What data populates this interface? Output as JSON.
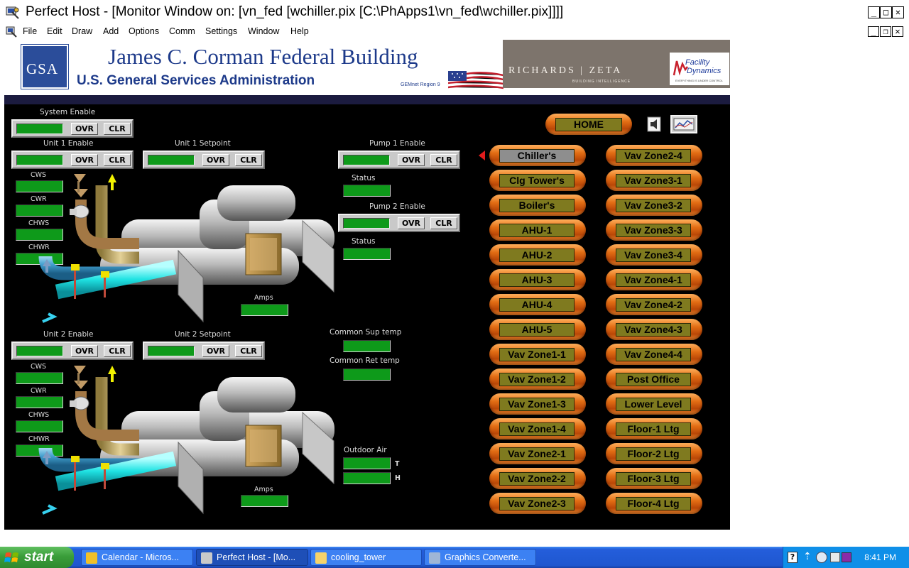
{
  "window": {
    "title": "Perfect Host - [Monitor Window on: [vn_fed [wchiller.pix [C:\\PhApps1\\vn_fed\\wchiller.pix]]]]",
    "menu": [
      "File",
      "Edit",
      "Draw",
      "Add",
      "Options",
      "Comm",
      "Settings",
      "Window",
      "Help"
    ]
  },
  "banner": {
    "logo_text": "GSA",
    "building_name": "James C. Corman Federal Building",
    "agency": "U.S. General Services Administration",
    "region": "GEMnet Region 9",
    "partner": "RICHARDS | ZETA",
    "partner_sub": "BUILDING INTELLIGENCE",
    "fd_line1": "Facility",
    "fd_line2": "Dynamics",
    "fd_tag": "EVERYTHING IS UNDER CONTROL"
  },
  "controls": {
    "ovr": "OVR",
    "clr": "CLR",
    "system_enable": "System Enable",
    "unit1_enable": "Unit 1 Enable",
    "unit1_setpoint": "Unit 1 Setpoint",
    "unit2_enable": "Unit 2 Enable",
    "unit2_setpoint": "Unit 2 Setpoint",
    "pump1_enable": "Pump 1 Enable",
    "pump2_enable": "Pump 2 Enable",
    "status": "Status",
    "cws": "CWS",
    "cwr": "CWR",
    "chws": "CHWS",
    "chwr": "CHWR",
    "amps": "Amps",
    "common_sup_temp": "Common Sup temp",
    "common_ret_temp": "Common Ret temp",
    "outdoor_air": "Outdoor Air",
    "t": "T",
    "h": "H"
  },
  "nav": {
    "home": "HOME",
    "left": [
      "Chiller's",
      "Clg Tower's",
      "Boiler's",
      "AHU-1",
      "AHU-2",
      "AHU-3",
      "AHU-4",
      "AHU-5",
      "Vav Zone1-1",
      "Vav Zone1-2",
      "Vav Zone1-3",
      "Vav Zone1-4",
      "Vav Zone2-1",
      "Vav Zone2-2",
      "Vav Zone2-3"
    ],
    "right": [
      "Vav Zone2-4",
      "Vav Zone3-1",
      "Vav Zone3-2",
      "Vav Zone3-3",
      "Vav Zone3-4",
      "Vav Zone4-1",
      "Vav Zone4-2",
      "Vav Zone4-3",
      "Vav Zone4-4",
      "Post Office",
      "Lower Level",
      "Floor-1 Ltg",
      "Floor-2 Ltg",
      "Floor-3 Ltg",
      "Floor-4 Ltg"
    ],
    "active": "Chiller's"
  },
  "taskbar": {
    "start": "start",
    "tasks": [
      "Calendar - Micros...",
      "Perfect Host - [Mo...",
      "cooling_tower",
      "Graphics Converte..."
    ],
    "active_task": "Perfect Host - [Mo...",
    "clock": "8:41 PM"
  }
}
